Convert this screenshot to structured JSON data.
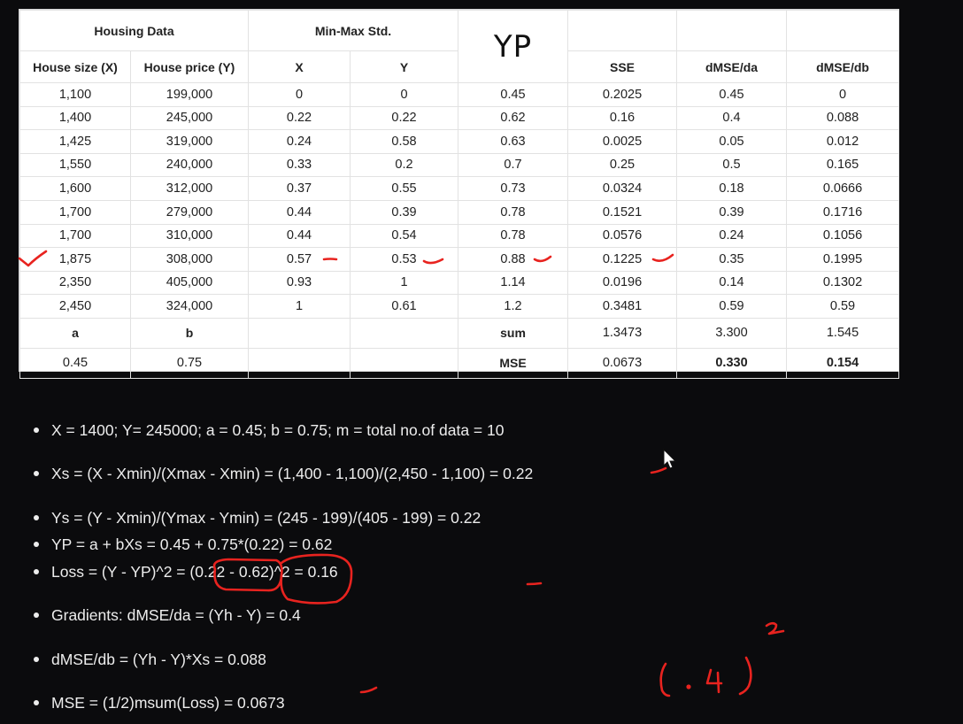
{
  "table": {
    "group_headers": [
      "Housing Data",
      "Min-Max Std.",
      "",
      "",
      "",
      ""
    ],
    "columns": [
      "House size (X)",
      "House price (Y)",
      "X",
      "Y",
      "YP",
      "SSE",
      "dMSE/da",
      "dMSE/db"
    ],
    "rows": [
      [
        "1,100",
        "199,000",
        "0",
        "0",
        "0.45",
        "0.2025",
        "0.45",
        "0"
      ],
      [
        "1,400",
        "245,000",
        "0.22",
        "0.22",
        "0.62",
        "0.16",
        "0.4",
        "0.088"
      ],
      [
        "1,425",
        "319,000",
        "0.24",
        "0.58",
        "0.63",
        "0.0025",
        "0.05",
        "0.012"
      ],
      [
        "1,550",
        "240,000",
        "0.33",
        "0.2",
        "0.7",
        "0.25",
        "0.5",
        "0.165"
      ],
      [
        "1,600",
        "312,000",
        "0.37",
        "0.55",
        "0.73",
        "0.0324",
        "0.18",
        "0.0666"
      ],
      [
        "1,700",
        "279,000",
        "0.44",
        "0.39",
        "0.78",
        "0.1521",
        "0.39",
        "0.1716"
      ],
      [
        "1,700",
        "310,000",
        "0.44",
        "0.54",
        "0.78",
        "0.0576",
        "0.24",
        "0.1056"
      ],
      [
        "1,875",
        "308,000",
        "0.57",
        "0.53",
        "0.88",
        "0.1225",
        "0.35",
        "0.1995"
      ],
      [
        "2,350",
        "405,000",
        "0.93",
        "1",
        "1.14",
        "0.0196",
        "0.14",
        "0.1302"
      ],
      [
        "2,450",
        "324,000",
        "1",
        "0.61",
        "1.2",
        "0.3481",
        "0.59",
        "0.59"
      ]
    ],
    "param_labels": {
      "a": "a",
      "b": "b"
    },
    "params": {
      "a": "0.45",
      "b": "0.75"
    },
    "sum": {
      "label": "sum",
      "sse": "1.3473",
      "dmse_da": "3.300",
      "dmse_db": "1.545"
    },
    "mse": {
      "label": "MSE",
      "sse": "0.0673",
      "dmse_da": "0.330",
      "dmse_db": "0.154"
    }
  },
  "notes": [
    "X = 1400; Y= 245000; a = 0.45; b = 0.75; m = total no.of data = 10",
    "Xs = (X - Xmin)/(Xmax - Xmin) = (1,400 - 1,100)/(2,450 - 1,100) = 0.22",
    "Ys = (Y - Xmin)/(Ymax - Ymin) = (245 - 199)/(405 - 199) = 0.22",
    "YP = a + bXs = 0.45 + 0.75*(0.22) = 0.62",
    "Loss = (Y - YP)^2 = (0.22 - 0.62)^2 = 0.16",
    "Gradients: dMSE/da = (Yh - Y) = 0.4",
    "dMSE/db = (Yh - Y)*Xs = 0.088",
    "MSE = (1/2)msum(Loss) = 0.0673"
  ],
  "annotation": {
    "handwritten": "(.4)",
    "superscript": "2"
  },
  "colors": {
    "background": "#0b0b0d",
    "table_bg": "#ffffff",
    "ink": "#e8231f",
    "note_text": "#ededed"
  },
  "icons": {
    "cursor": "cursor-arrow-icon"
  }
}
